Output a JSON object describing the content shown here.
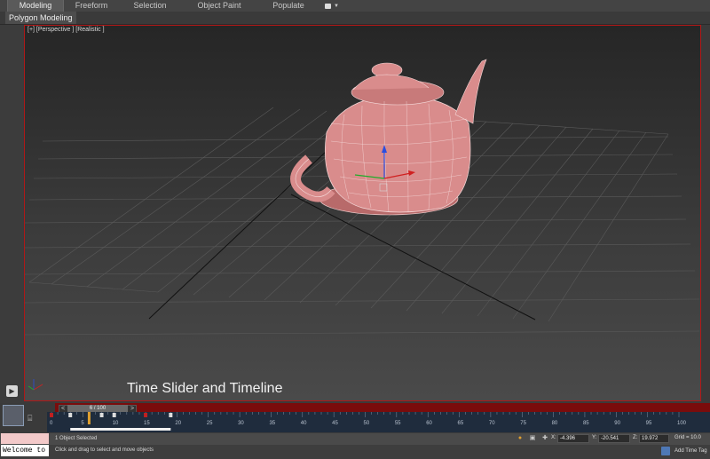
{
  "ribbon": {
    "tabs": [
      {
        "label": "Modeling",
        "active": true
      },
      {
        "label": "Freeform",
        "active": false
      },
      {
        "label": "Selection",
        "active": false
      },
      {
        "label": "Object Paint",
        "active": false
      },
      {
        "label": "Populate",
        "active": false
      }
    ],
    "sub_label": "Polygon Modeling"
  },
  "viewport": {
    "label": "[+] [Perspective ] [Realistic ]",
    "caption": "Time Slider and Timeline",
    "border_color": "#b01818",
    "object_color": "#d98c8c"
  },
  "time_slider": {
    "position": "6 / 100",
    "prev": "<",
    "next": ">",
    "ticks": [
      "0",
      "5",
      "10",
      "15",
      "20",
      "25",
      "30",
      "35",
      "40",
      "45",
      "50",
      "55",
      "60",
      "65",
      "70",
      "75",
      "80",
      "85",
      "90",
      "95",
      "100"
    ]
  },
  "status": {
    "welcome": "Welcome to MAXScript.",
    "selection": "1 Object Selected",
    "hint": "Click and drag to select and move objects",
    "x_label": "X:",
    "x_value": "-4.396",
    "y_label": "Y:",
    "y_value": "-20.541",
    "z_label": "Z:",
    "z_value": "19.972",
    "grid": "Grid = 10.0",
    "time_tag": "Add Time Tag"
  }
}
